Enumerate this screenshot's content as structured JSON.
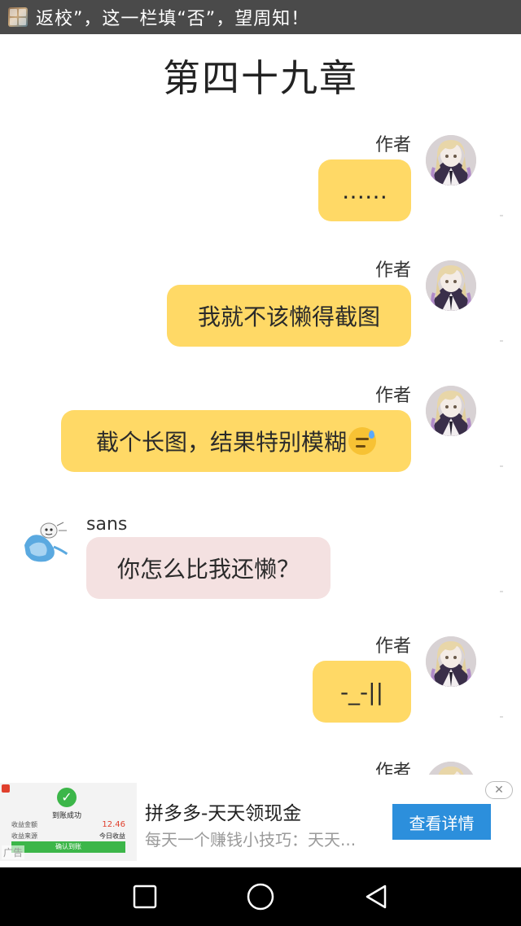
{
  "status_bar": {
    "notification_text": "返校”，这一栏填“否”，望周知！",
    "app_icon": "notification-app-icon"
  },
  "chapter": {
    "title": "第四十九章"
  },
  "messages": [
    {
      "side": "right",
      "sender": "作者",
      "text": "……",
      "avatar": "author-avatar-icon"
    },
    {
      "side": "right",
      "sender": "作者",
      "text": "我就不该懒得截图",
      "avatar": "author-avatar-icon"
    },
    {
      "side": "right",
      "sender": "作者",
      "text": "截个长图，结果特别模糊",
      "emoji": "sweat-smile-emoji",
      "avatar": "author-avatar-icon"
    },
    {
      "side": "left",
      "sender": "sans",
      "text": "你怎么比我还懒？",
      "avatar": "sans-avatar-icon"
    },
    {
      "side": "right",
      "sender": "作者",
      "text": "-_-||",
      "avatar": "author-avatar-icon"
    },
    {
      "side": "right",
      "sender": "作者",
      "text": "",
      "avatar": "author-avatar-icon"
    }
  ],
  "ad": {
    "title": "拼多多-天天领现金",
    "description": "每天一个赚钱小技巧：天天...",
    "cta_label": "查看详情",
    "close_icon": "close-icon",
    "thumbnail": {
      "success_text": "到账成功",
      "row1_label": "收益金额",
      "row1_value": "12.46",
      "row2_label": "收益来源",
      "row2_value": "今日收益",
      "confirm_label": "确认到账",
      "ad_label": "广告"
    }
  },
  "nav_bar": {
    "buttons": [
      "recents-square-icon",
      "home-circle-icon",
      "back-triangle-icon"
    ]
  },
  "colors": {
    "author_bubble": "#ffd966",
    "sans_bubble": "#f4e1e1",
    "status_bar": "#4a4a4a",
    "cta_button": "#2c8fdc",
    "nav_bar": "#000000"
  }
}
